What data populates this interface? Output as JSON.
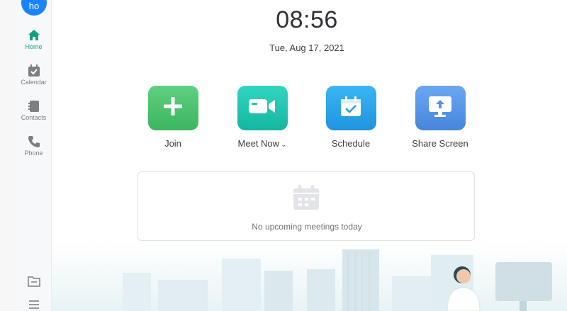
{
  "user": {
    "avatar_initials": "ho"
  },
  "sidebar": {
    "items": [
      {
        "label": "Home",
        "icon": "home-icon",
        "active": true
      },
      {
        "label": "Calendar",
        "icon": "calendar-icon",
        "active": false
      },
      {
        "label": "Contacts",
        "icon": "contacts-icon",
        "active": false
      },
      {
        "label": "Phone",
        "icon": "phone-icon",
        "active": false
      }
    ],
    "bottom_icons": [
      "folder-icon",
      "menu-icon"
    ]
  },
  "clock": {
    "time": "08:56",
    "date": "Tue, Aug 17, 2021"
  },
  "actions": [
    {
      "label": "Join",
      "icon": "plus-icon"
    },
    {
      "label": "Meet Now",
      "icon": "video-camera-icon",
      "has_dropdown": true
    },
    {
      "label": "Schedule",
      "icon": "calendar-check-icon"
    },
    {
      "label": "Share Screen",
      "icon": "screen-share-icon"
    }
  ],
  "meetings": {
    "empty_text": "No upcoming meetings today",
    "icon": "calendar-empty-icon"
  },
  "colors": {
    "accent": "#10a37f",
    "avatar": "#1a84ff",
    "join": "#45bd68",
    "meet_now": "#1fc4ae",
    "schedule": "#27a3e8",
    "share_screen": "#5893e6"
  }
}
